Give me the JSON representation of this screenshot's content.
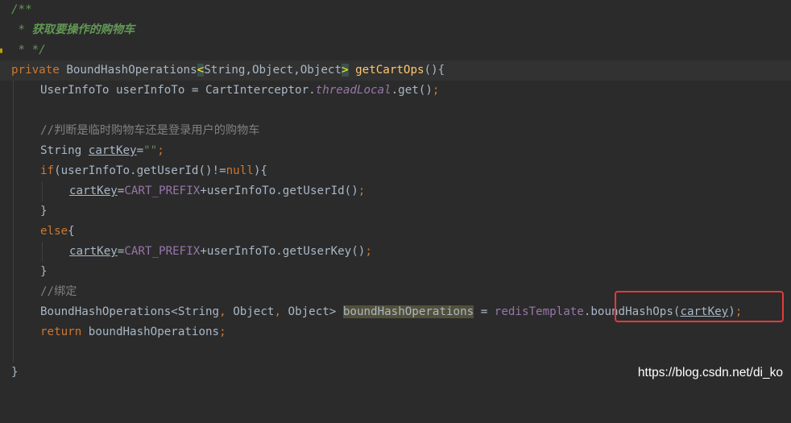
{
  "code": {
    "l1": "/**",
    "l2_star": " * ",
    "l2_text": "获取要操作的购物车",
    "l3": " * */",
    "l4": {
      "kw_private": "private ",
      "type": "BoundHashOperations",
      "generic_open": "<",
      "generic_args": "String,Object,Object",
      "generic_close": ">",
      "space": " ",
      "method": "getCartOps",
      "tail": "(){"
    },
    "l5": {
      "a": "UserInfoTo userInfoTo = CartInterceptor.",
      "field": "threadLocal",
      "b": ".get()",
      "semi": ";"
    },
    "l7": "//判断是临时购物车还是登录用户的购物车",
    "l8": {
      "a": "String ",
      "var": "cartKey",
      "eq": "=",
      "str": "\"\"",
      "semi": ";"
    },
    "l9": {
      "kw_if": "if",
      "a": "(userInfoTo.getUserId()!=",
      "kw_null": "null",
      "b": "){"
    },
    "l10": {
      "var": "cartKey",
      "eq": "=",
      "const": "CART_PREFIX",
      "b": "+userInfoTo.getUserId()",
      "semi": ";"
    },
    "l11": "}",
    "l12": {
      "kw_else": "else",
      "b": "{"
    },
    "l13": {
      "var": "cartKey",
      "eq": "=",
      "const": "CART_PREFIX",
      "b": "+userInfoTo.getUserKey()",
      "semi": ";"
    },
    "l14": "}",
    "l15": "//绑定",
    "l16": {
      "a": "BoundHashOperations<String",
      "c1": ", ",
      "b": "Object",
      "c2": ", ",
      "c": "Object> ",
      "decl": "boundHashOperations",
      "d": " = ",
      "field": "redisTemplate",
      "e": ".boundHashOps(",
      "var": "cartKey",
      "f": ")",
      "semi": ";"
    },
    "l17": {
      "kw_return": "return ",
      "a": "boundHashOperations",
      "semi": ";"
    },
    "l19": "}"
  },
  "watermark": "https://blog.csdn.net/di_ko",
  "colors": {
    "background": "#2b2b2b",
    "keyword": "#cc7832",
    "method": "#ffc66d",
    "field": "#9876aa",
    "string": "#6a8759",
    "comment": "#808080",
    "doc": "#629755",
    "highlight_box": "#e53a3a"
  }
}
